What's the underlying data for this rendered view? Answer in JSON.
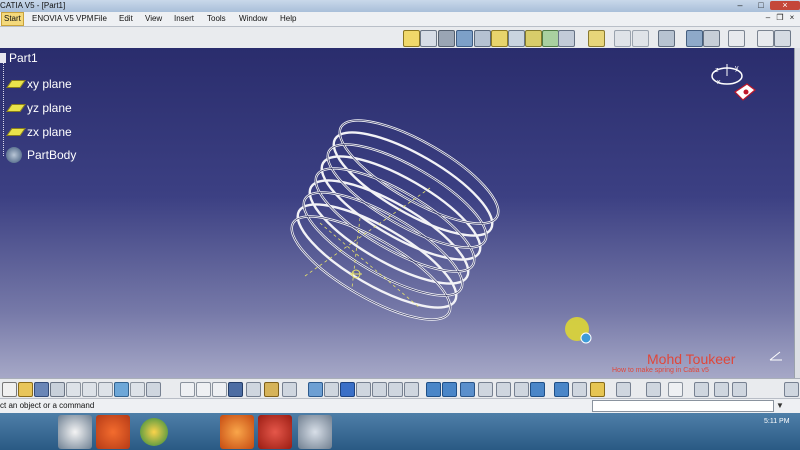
{
  "window": {
    "title": "CATIA V5 - [Part1]"
  },
  "menu": {
    "items": [
      {
        "label": "Start",
        "active": true
      },
      {
        "label": "ENOVIA V5 VPM"
      },
      {
        "label": "File"
      },
      {
        "label": "Edit"
      },
      {
        "label": "View"
      },
      {
        "label": "Insert"
      },
      {
        "label": "Tools"
      },
      {
        "label": "Window"
      },
      {
        "label": "Help"
      }
    ]
  },
  "tree": {
    "root": "Part1",
    "items": [
      "xy plane",
      "yz plane",
      "zx plane",
      "PartBody"
    ]
  },
  "overlay": {
    "name": "Mohd Toukeer",
    "subtitle": "How to make spring in Catia v5"
  },
  "status": {
    "prompt": "ct an object or a command"
  },
  "taskbar": {
    "clock": "5:11 PM"
  },
  "colors": {
    "viewport_top": "#2a2d6d",
    "viewport_bottom": "#a6a8c7",
    "watermark": "#e0473a",
    "active_menu": "#f4d97b"
  }
}
